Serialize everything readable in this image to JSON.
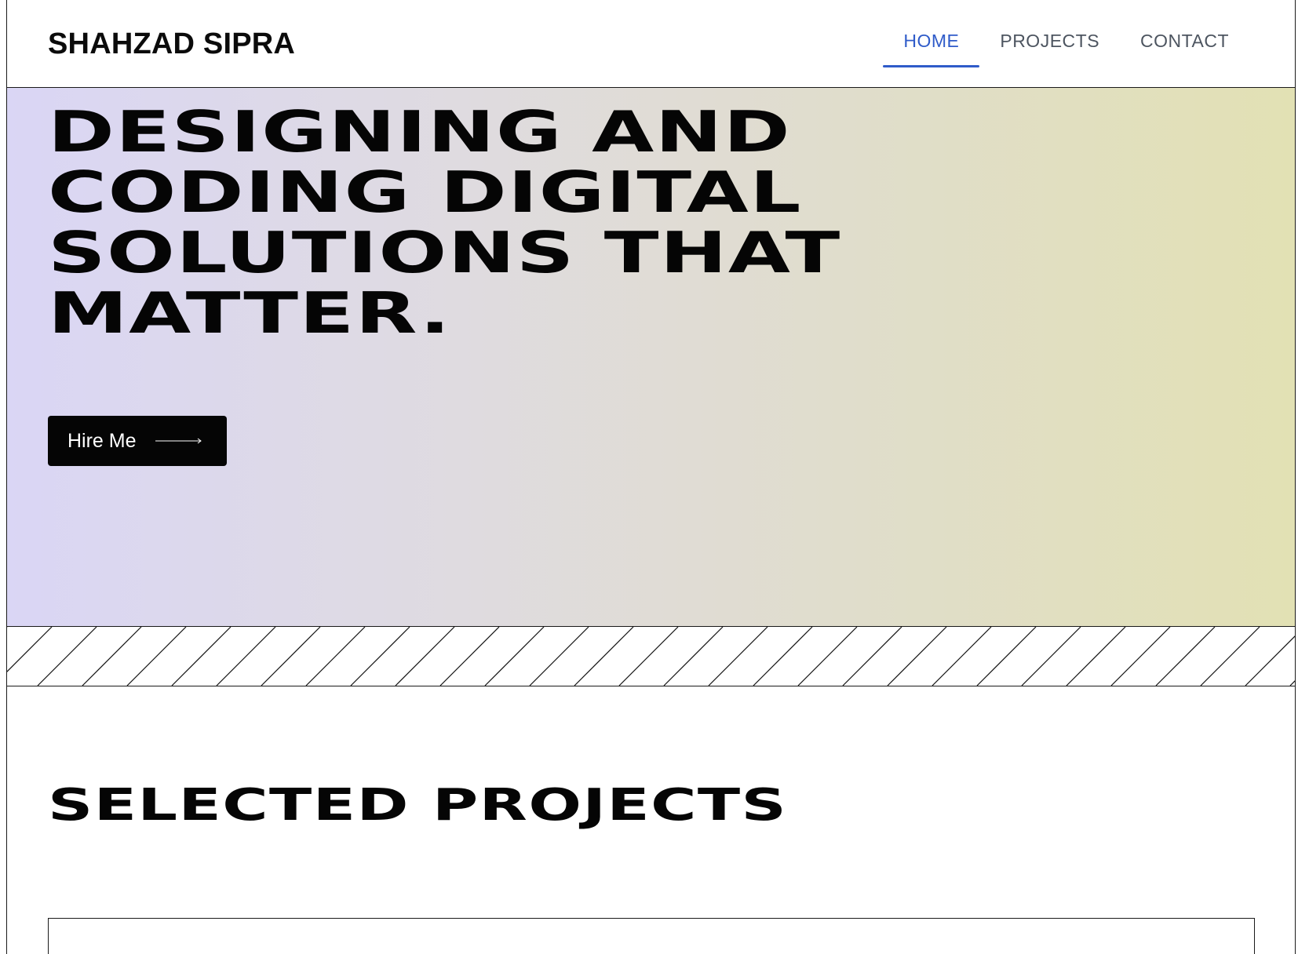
{
  "header": {
    "brand": "SHAHZAD SIPRA",
    "nav": [
      {
        "label": "HOME",
        "active": true
      },
      {
        "label": "PROJECTS",
        "active": false
      },
      {
        "label": "CONTACT",
        "active": false
      }
    ],
    "accent_color": "#2f5bc9"
  },
  "hero": {
    "title_lines": [
      "DESIGNING AND",
      "CODING DIGITAL",
      "SOLUTIONS THAT",
      "MATTER."
    ],
    "cta_label": "Hire Me",
    "cta_icon": "arrow-right-icon",
    "gradient": [
      "#dad6f5",
      "#e2e1b4"
    ]
  },
  "projects": {
    "title": "SELECTED PROJECTS"
  }
}
